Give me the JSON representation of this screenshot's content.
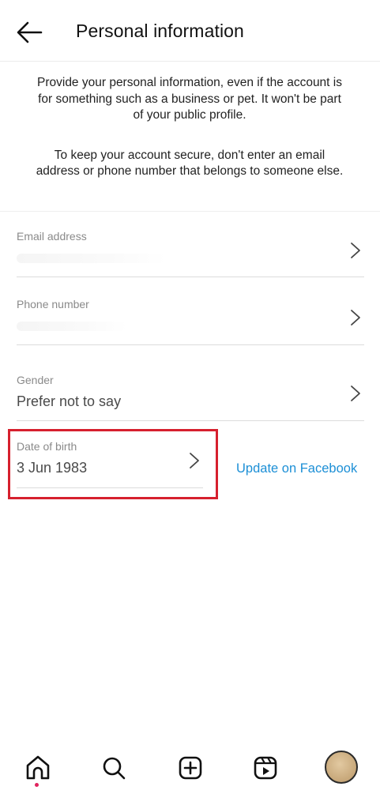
{
  "header": {
    "title": "Personal information",
    "back_icon": "arrow-left-icon"
  },
  "info": {
    "paragraph1": "Provide your personal information, even if the account is for something such as a business or pet. It won't be part of your public profile.",
    "paragraph2": "To keep your account secure, don't enter an email address or phone number that belongs to someone else."
  },
  "fields": {
    "email": {
      "label": "Email address"
    },
    "phone": {
      "label": "Phone number"
    },
    "gender": {
      "label": "Gender",
      "value": "Prefer not to say"
    },
    "dob": {
      "label": "Date of birth",
      "value": "3 Jun 1983"
    }
  },
  "facebook_link": "Update on Facebook",
  "highlight_color": "#d6202e",
  "link_color": "#1c8fd6",
  "bottom_nav": {
    "items": [
      "home-icon",
      "search-icon",
      "create-icon",
      "reels-icon",
      "profile-avatar"
    ],
    "notification_dot_color": "#e0245e"
  }
}
